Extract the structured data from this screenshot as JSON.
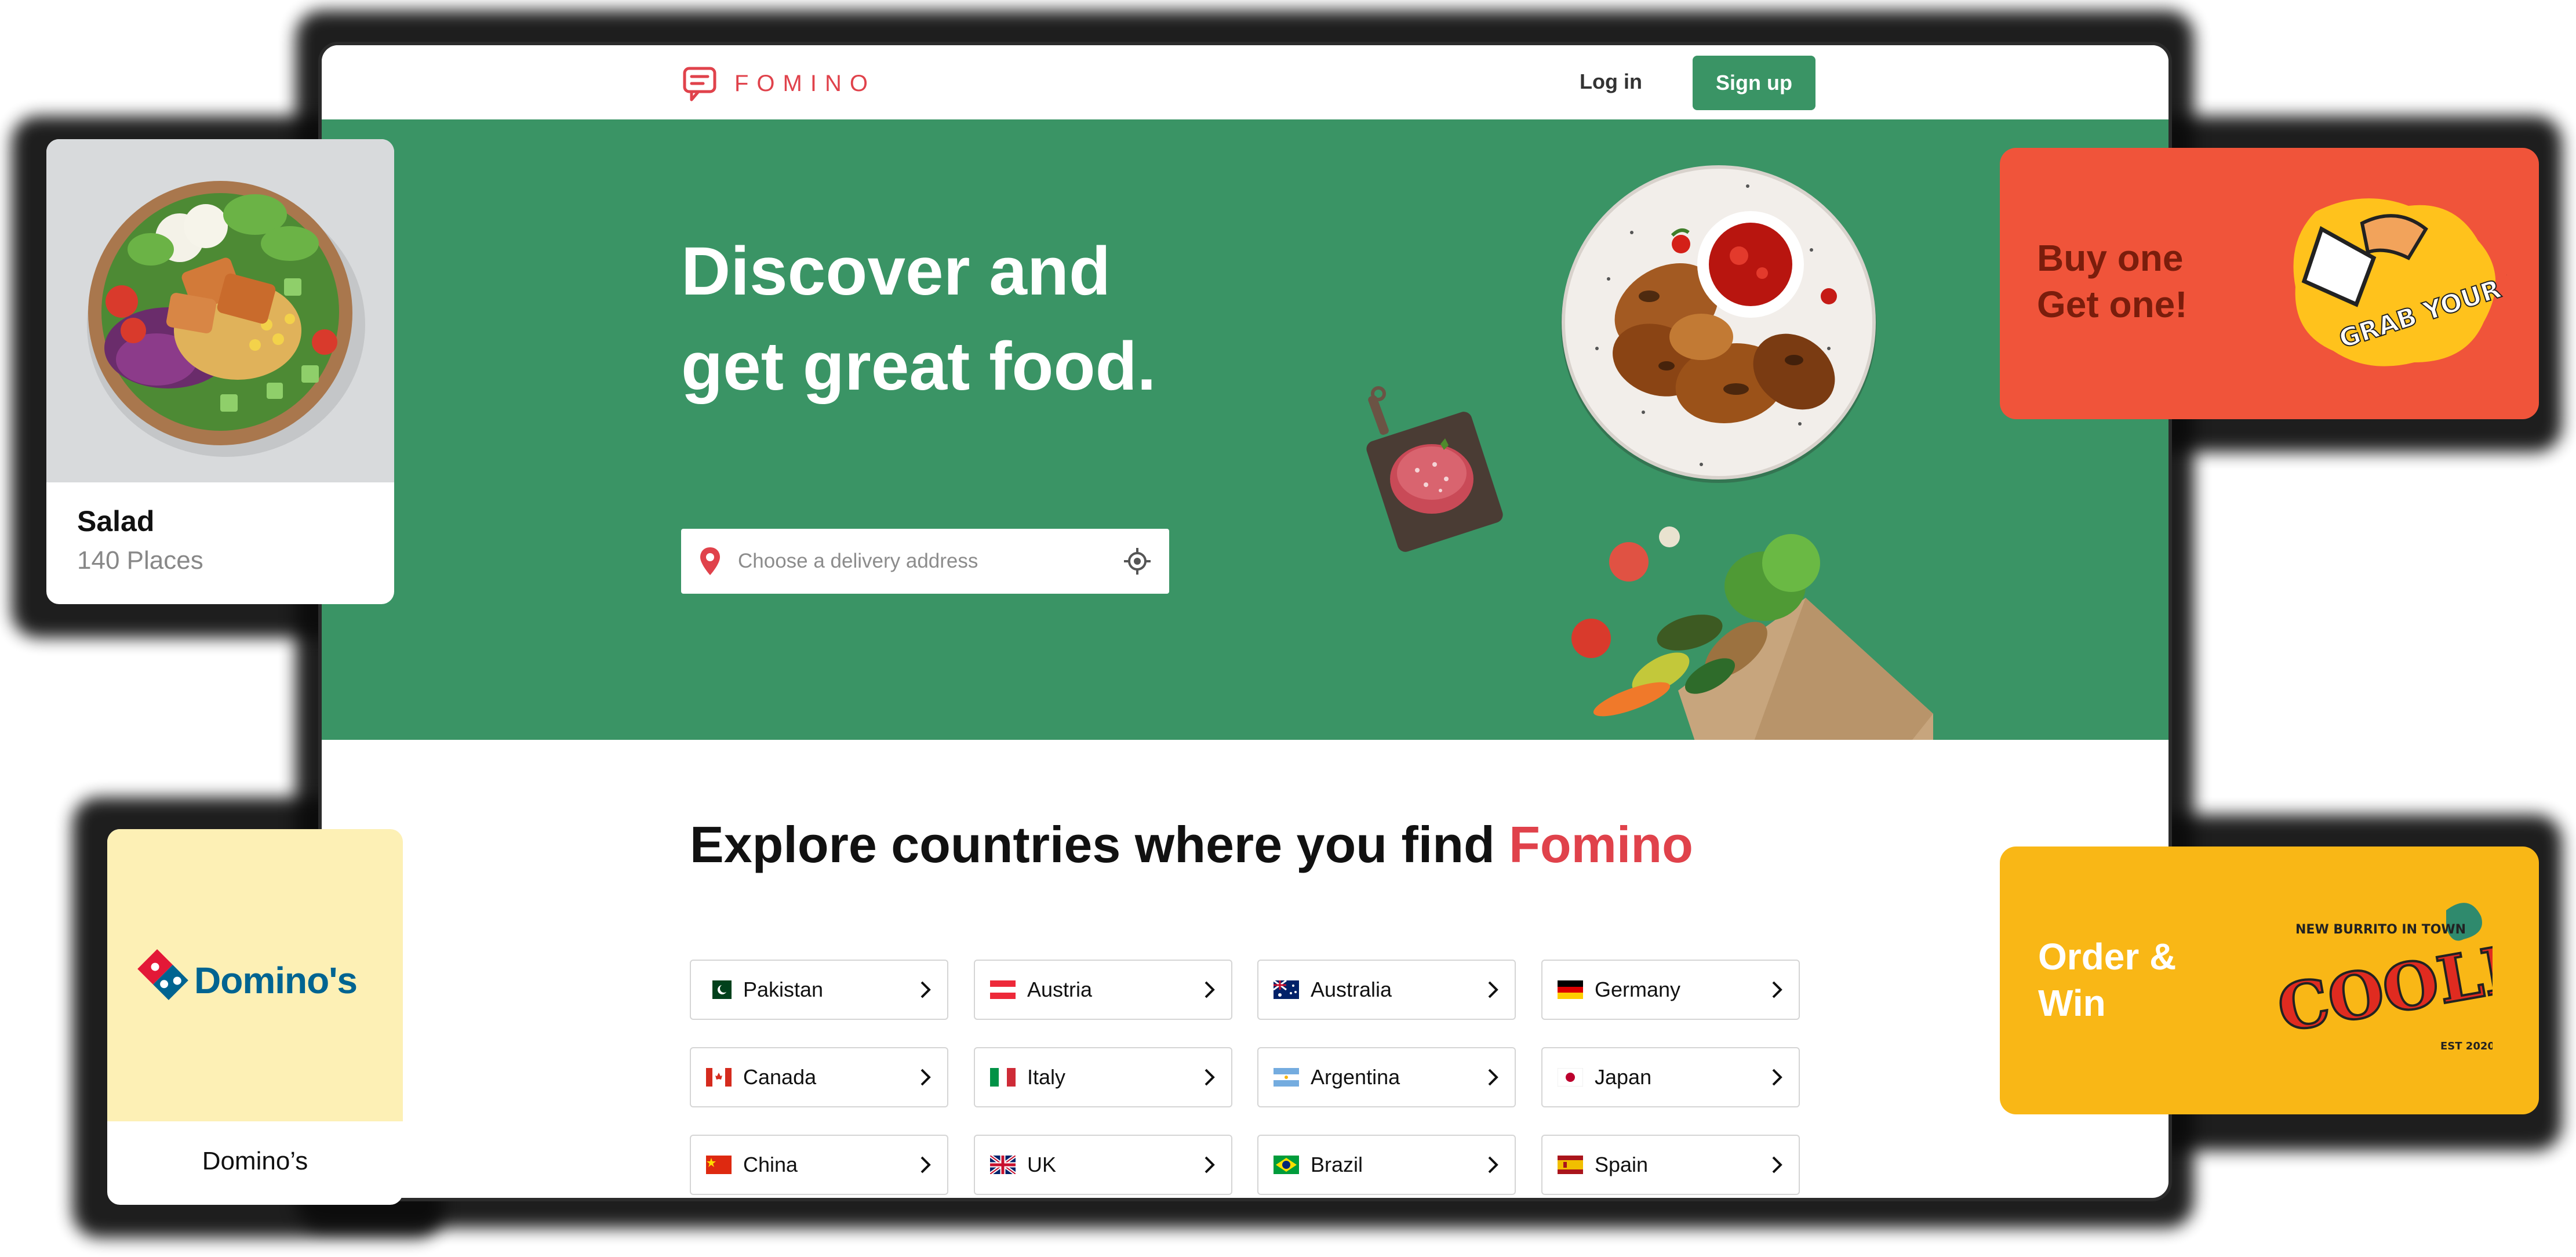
{
  "brand": {
    "name": "FOMINO",
    "accent": "#e0424b",
    "green": "#3a9465"
  },
  "nav": {
    "login": "Log in",
    "signup": "Sign up"
  },
  "hero": {
    "line1": "Discover and",
    "line2": "get great food.",
    "address_placeholder": "Choose a delivery address"
  },
  "explore": {
    "prefix": "Explore countries where you find ",
    "brand": "Fomino"
  },
  "countries": [
    {
      "name": "Pakistan",
      "flag": "pakistan-flag"
    },
    {
      "name": "Austria",
      "flag": "austria-flag"
    },
    {
      "name": "Australia",
      "flag": "australia-flag"
    },
    {
      "name": "Germany",
      "flag": "germany-flag"
    },
    {
      "name": "Canada",
      "flag": "canada-flag"
    },
    {
      "name": "Italy",
      "flag": "italy-flag"
    },
    {
      "name": "Argentina",
      "flag": "argentina-flag"
    },
    {
      "name": "Japan",
      "flag": "japan-flag"
    },
    {
      "name": "China",
      "flag": "china-flag"
    },
    {
      "name": "UK",
      "flag": "uk-flag"
    },
    {
      "name": "Brazil",
      "flag": "brazil-flag"
    },
    {
      "name": "Spain",
      "flag": "spain-flag"
    }
  ],
  "cards": {
    "salad": {
      "title": "Salad",
      "subtitle": "140 Places"
    },
    "dominos": {
      "logo": "Domino's",
      "title": "Domino’s"
    },
    "promo_bogo": {
      "line1": "Buy one",
      "line2": "Get one!",
      "sticker": "GRAB YOUR MUNCHIES",
      "color": "#f0543a"
    },
    "promo_order": {
      "line1": "Order &",
      "line2": "Win",
      "sticker_top": "NEW BURRITO IN TOWN",
      "sticker": "COOLIOS",
      "sticker_est": "EST 2020",
      "color": "#f9b716"
    }
  }
}
